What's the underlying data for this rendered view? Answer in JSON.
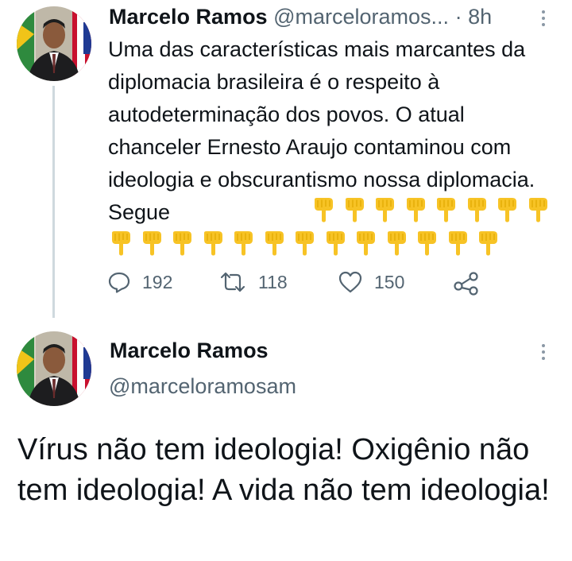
{
  "tweet1": {
    "author_name": "Marcelo Ramos",
    "handle": "@marceloramos...",
    "time": "8h",
    "text": "Uma das características mais marcantes da diplomacia brasileira é o respeito à autodeterminação dos povos. O atual chanceler Ernesto Araujo contaminou com ideologia e obscurantismo nossa diplomacia. Segue",
    "emoji_name": "backhand-index-pointing-down-emoji",
    "emoji_count_line1": 8,
    "emoji_count_line2": 13,
    "replies": "192",
    "retweets": "118",
    "likes": "150"
  },
  "tweet2": {
    "author_name": "Marcelo Ramos",
    "handle": "@marceloramosam",
    "text": "Vírus não tem ideologia! Oxigênio não tem ideologia! A vida não tem ideologia!"
  },
  "colors": {
    "text": "#0f1419",
    "secondary": "#536471",
    "thread_line": "#cfd9de",
    "emoji_yellow": "#f7c325"
  }
}
